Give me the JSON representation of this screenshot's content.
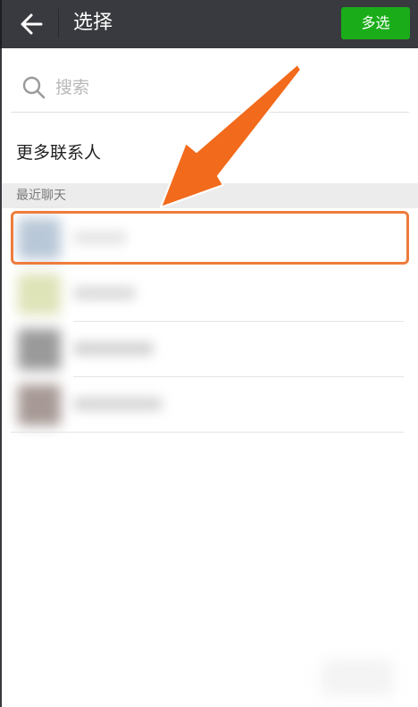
{
  "header": {
    "title": "选择",
    "multi_select_label": "多选"
  },
  "search": {
    "placeholder": "搜索"
  },
  "more_contacts_label": "更多联系人",
  "recent_section_label": "最近聊天",
  "icons": {
    "back": "arrow-left-icon",
    "search": "search-icon"
  },
  "colors": {
    "topbar": "#393a3f",
    "accent_green": "#1aad19",
    "annotation_orange": "#f26a1b",
    "highlight_border": "#ef7c3c"
  }
}
